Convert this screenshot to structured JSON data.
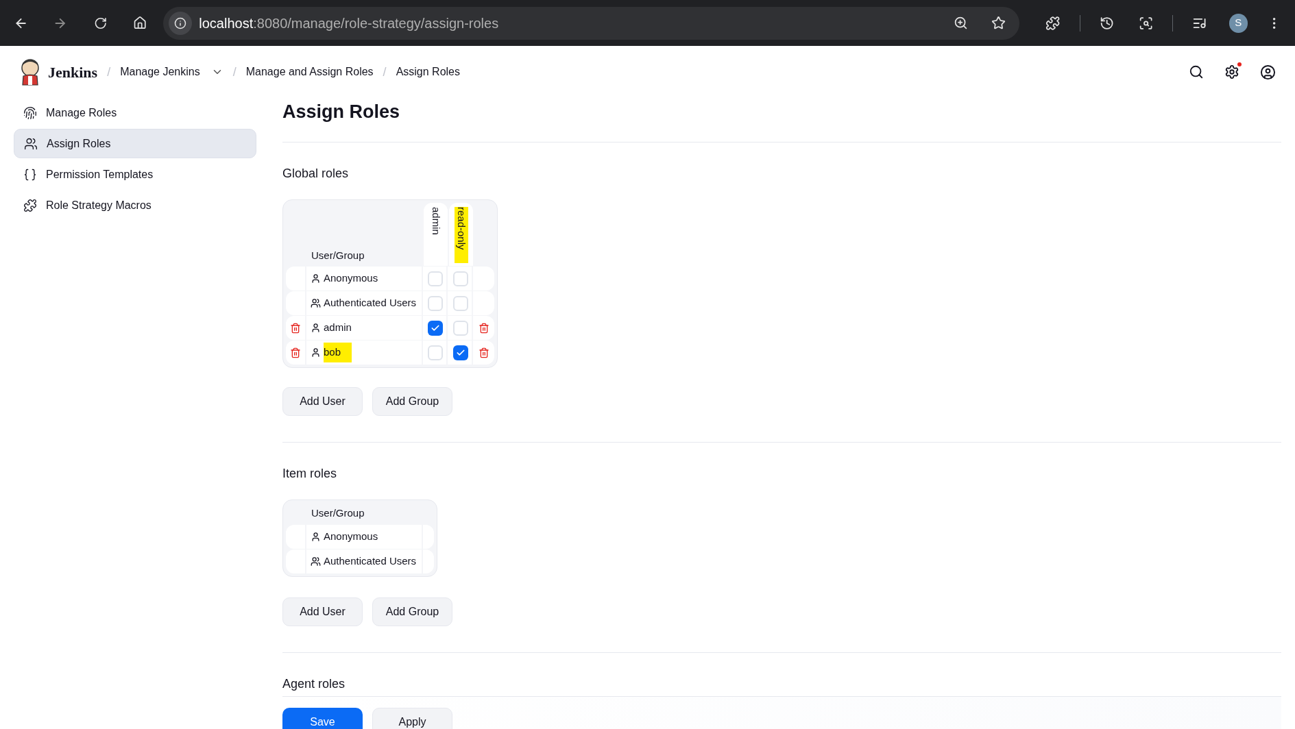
{
  "browser": {
    "url_host": "localhost",
    "url_rest": ":8080/manage/role-strategy/assign-roles",
    "profile": "S"
  },
  "header": {
    "brand": "Jenkins",
    "separator": "/",
    "breadcrumbs": [
      {
        "label": "Manage Jenkins",
        "dropdown": true
      },
      {
        "label": "Manage and Assign Roles",
        "dropdown": false
      },
      {
        "label": "Assign Roles",
        "dropdown": false
      }
    ],
    "settings_alert": true
  },
  "sidebar": {
    "items": [
      {
        "label": "Manage Roles",
        "selected": false
      },
      {
        "label": "Assign Roles",
        "selected": true
      },
      {
        "label": "Permission Templates",
        "selected": false
      },
      {
        "label": "Role Strategy Macros",
        "selected": false
      }
    ]
  },
  "title": "Assign Roles",
  "sections": [
    {
      "heading": "Global roles",
      "column_header": "User/Group",
      "roles": [
        {
          "name": "admin",
          "highlighted": false
        },
        {
          "name": "read-only",
          "highlighted": true
        }
      ],
      "rows": [
        {
          "name": "Anonymous",
          "kind": "user",
          "deletable": false,
          "highlighted": false,
          "cells": [
            {
              "checked": false
            },
            {
              "checked": false
            }
          ]
        },
        {
          "name": "Authenticated Users",
          "kind": "group",
          "deletable": false,
          "highlighted": false,
          "cells": [
            {
              "checked": false
            },
            {
              "checked": false
            }
          ]
        },
        {
          "name": "admin",
          "kind": "user",
          "deletable": true,
          "highlighted": false,
          "cells": [
            {
              "checked": true
            },
            {
              "checked": false
            }
          ]
        },
        {
          "name": "bob",
          "kind": "user",
          "deletable": true,
          "highlighted": true,
          "cells": [
            {
              "checked": false
            },
            {
              "checked": true
            }
          ]
        }
      ],
      "buttons": [
        "Add User",
        "Add Group"
      ]
    },
    {
      "heading": "Item roles",
      "column_header": "User/Group",
      "rows": [
        {
          "name": "Anonymous",
          "kind": "user",
          "deletable": false,
          "highlighted": false
        },
        {
          "name": "Authenticated Users",
          "kind": "group",
          "deletable": false,
          "highlighted": false
        }
      ],
      "buttons": [
        "Add User",
        "Add Group"
      ]
    },
    {
      "heading": "Agent roles"
    }
  ],
  "footer_buttons": [
    {
      "label": "Save",
      "primary": true
    },
    {
      "label": "Apply",
      "primary": false
    }
  ]
}
